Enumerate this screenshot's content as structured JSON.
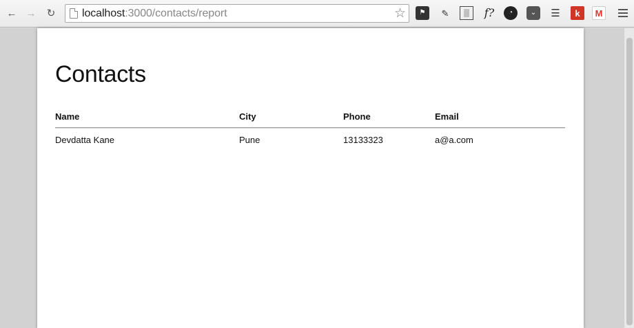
{
  "browser": {
    "back_icon": "arrow-left-icon",
    "forward_icon": "arrow-right-icon",
    "reload_icon": "reload-icon",
    "url_host": "localhost",
    "url_path": ":3000/contacts/report",
    "extensions": [
      {
        "name": "bug-icon"
      },
      {
        "name": "pen-icon"
      },
      {
        "name": "qr-icon"
      },
      {
        "name": "font-icon",
        "label": "f?"
      },
      {
        "name": "speedometer-icon"
      },
      {
        "name": "pocket-icon"
      },
      {
        "name": "layers-icon"
      },
      {
        "name": "k-icon",
        "label": "k"
      },
      {
        "name": "gmail-icon",
        "label": "M"
      }
    ]
  },
  "page": {
    "title": "Contacts",
    "columns": [
      "Name",
      "City",
      "Phone",
      "Email"
    ],
    "rows": [
      [
        "Devdatta Kane",
        "Pune",
        "13133323",
        "a@a.com"
      ]
    ]
  }
}
